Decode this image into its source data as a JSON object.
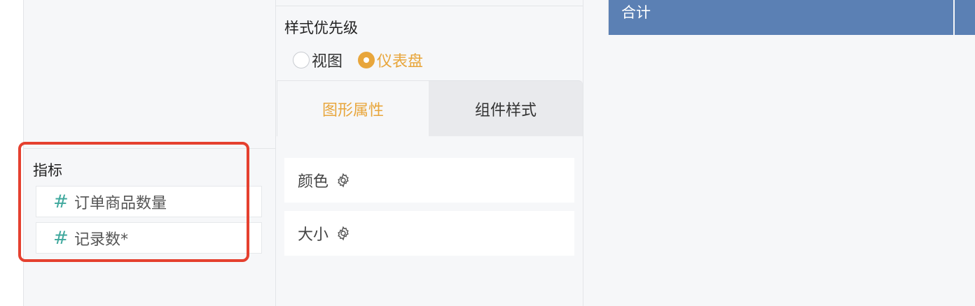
{
  "left_panel": {
    "metrics_title": "指标",
    "metrics": [
      {
        "icon": "#",
        "label": "订单商品数量"
      },
      {
        "icon": "#",
        "label": "记录数*"
      }
    ]
  },
  "style_panel": {
    "priority_label": "样式优先级",
    "options": [
      {
        "label": "视图",
        "selected": false
      },
      {
        "label": "仪表盘",
        "selected": true
      }
    ],
    "tabs": [
      {
        "label": "图形属性",
        "active": true
      },
      {
        "label": "组件样式",
        "active": false
      }
    ],
    "properties": [
      {
        "label": "颜色",
        "icon": "gear-icon"
      },
      {
        "label": "大小",
        "icon": "gear-icon"
      }
    ]
  },
  "table": {
    "header_cell": "合计"
  },
  "colors": {
    "accent": "#e8a63c",
    "hash": "#3fa89d",
    "table_header": "#5b80b4",
    "highlight": "#e5402f"
  }
}
